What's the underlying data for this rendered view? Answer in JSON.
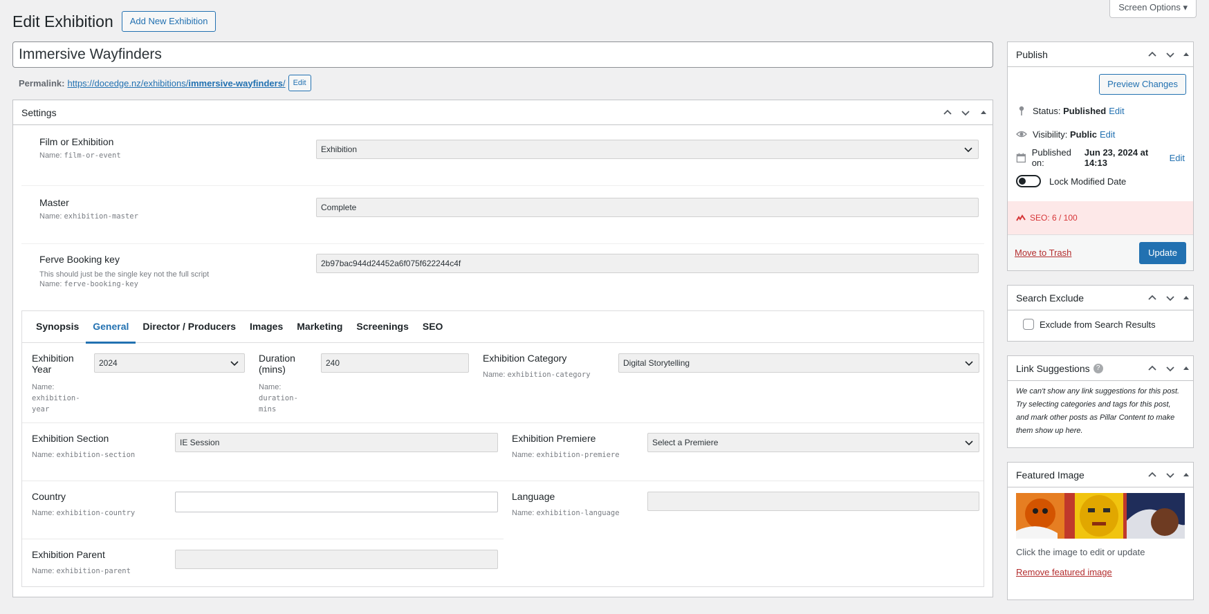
{
  "screen_options": "Screen Options ▾",
  "header": {
    "title": "Edit Exhibition",
    "add_new": "Add New Exhibition"
  },
  "post_title": "Immersive Wayfinders",
  "permalink": {
    "label": "Permalink:",
    "url_prefix": "https://docedge.nz/exhibitions/",
    "url_slug": "immersive-wayfinders",
    "url_suffix": "/",
    "edit": "Edit"
  },
  "settings": {
    "title": "Settings",
    "fields": [
      {
        "label": "Film or Exhibition",
        "desc": "",
        "name_label": "Name:",
        "name": "film-or-event",
        "value": "Exhibition"
      },
      {
        "label": "Master",
        "desc": "",
        "name_label": "Name:",
        "name": "exhibition-master",
        "value": "Complete"
      },
      {
        "label": "Ferve Booking key",
        "desc": "This should just be the single key not the full script",
        "name_label": "Name:",
        "name": "ferve-booking-key",
        "value": "2b97bac944d24452a6f075f622244c4f"
      }
    ],
    "tabs": [
      "Synopsis",
      "General",
      "Director / Producers",
      "Images",
      "Marketing",
      "Screenings",
      "SEO"
    ],
    "active_tab": "General",
    "general": {
      "year": {
        "label": "Exhibition Year",
        "name_label": "Name:",
        "name_a": "exhibition-",
        "name_b": "year",
        "value": "2024"
      },
      "duration": {
        "label_a": "Duration",
        "label_b": "(mins)",
        "name_label": "Name:",
        "name": "duration-mins",
        "value": "240"
      },
      "category": {
        "label": "Exhibition Category",
        "name_label": "Name:",
        "name": "exhibition-category",
        "value": "Digital Storytelling"
      },
      "section": {
        "label": "Exhibition Section",
        "name_label": "Name:",
        "name": "exhibition-section",
        "value": "IE Session"
      },
      "premiere": {
        "label": "Exhibition Premiere",
        "name_label": "Name:",
        "name": "exhibition-premiere",
        "value": "Select a Premiere"
      },
      "country": {
        "label": "Country",
        "name_label": "Name:",
        "name": "exhibition-country",
        "value": ""
      },
      "language": {
        "label": "Language",
        "name_label": "Name:",
        "name": "exhibition-language",
        "value": ""
      },
      "parent": {
        "label": "Exhibition Parent",
        "name_label": "Name:",
        "name": "exhibition-parent",
        "value": ""
      }
    }
  },
  "publish": {
    "title": "Publish",
    "preview": "Preview Changes",
    "status_label": "Status:",
    "status_value": "Published",
    "visibility_label": "Visibility:",
    "visibility_value": "Public",
    "published_label": "Published on:",
    "published_value": "Jun 23, 2024 at 14:13",
    "edit": "Edit",
    "lock_label": "Lock Modified Date",
    "seo": "SEO: 6 / 100",
    "trash": "Move to Trash",
    "update": "Update"
  },
  "search_exclude": {
    "title": "Search Exclude",
    "checkbox_label": "Exclude from Search Results"
  },
  "link_suggestions": {
    "title": "Link Suggestions",
    "help": "?",
    "text": "We can't show any link suggestions for this post. Try selecting categories and tags for this post, and mark other posts as Pillar Content to make them show up here."
  },
  "featured_image": {
    "title": "Featured Image",
    "caption": "Click the image to edit or update",
    "remove": "Remove featured image"
  },
  "colors": {
    "accent": "#2271b1",
    "danger": "#d63638",
    "seo_bg": "#fde8e8"
  }
}
